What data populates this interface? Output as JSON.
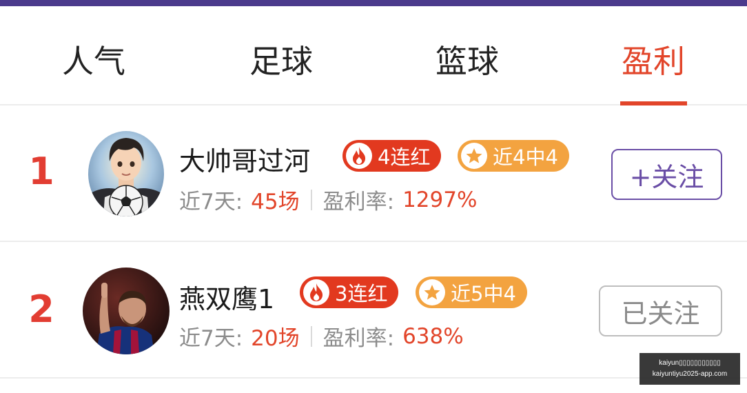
{
  "tabs": [
    {
      "label": "人气",
      "active": false
    },
    {
      "label": "足球",
      "active": false
    },
    {
      "label": "篮球",
      "active": false
    },
    {
      "label": "盈利",
      "active": true
    }
  ],
  "colors": {
    "accent": "#e2452a",
    "brand_bar": "#4b3a8c",
    "streak_badge": "#e2391f",
    "hits_badge": "#f3a340",
    "follow": "#6a4ea6"
  },
  "rows": [
    {
      "rank": "1",
      "name": "大帅哥过河",
      "streak_badge": "4连红",
      "hits_badge": "近4中4",
      "stats_label_1": "近7天:",
      "stats_value_1": "45场",
      "stats_label_2": "盈利率:",
      "stats_value_2": "1297%",
      "follow_label": "+关注",
      "followed": false,
      "avatar_icon": "anime-soccer-player-avatar"
    },
    {
      "rank": "2",
      "name": "燕双鹰1",
      "streak_badge": "3连红",
      "hits_badge": "近5中4",
      "stats_label_1": "近7天:",
      "stats_value_1": "20场",
      "stats_label_2": "盈利率:",
      "stats_value_2": "638%",
      "follow_label": "已关注",
      "followed": true,
      "avatar_icon": "footballer-photo-avatar"
    }
  ],
  "watermark": {
    "line1": "kaiyun▯▯▯▯▯▯▯▯▯▯▯",
    "line2": "kaiyuntiyu2025-app.com"
  }
}
